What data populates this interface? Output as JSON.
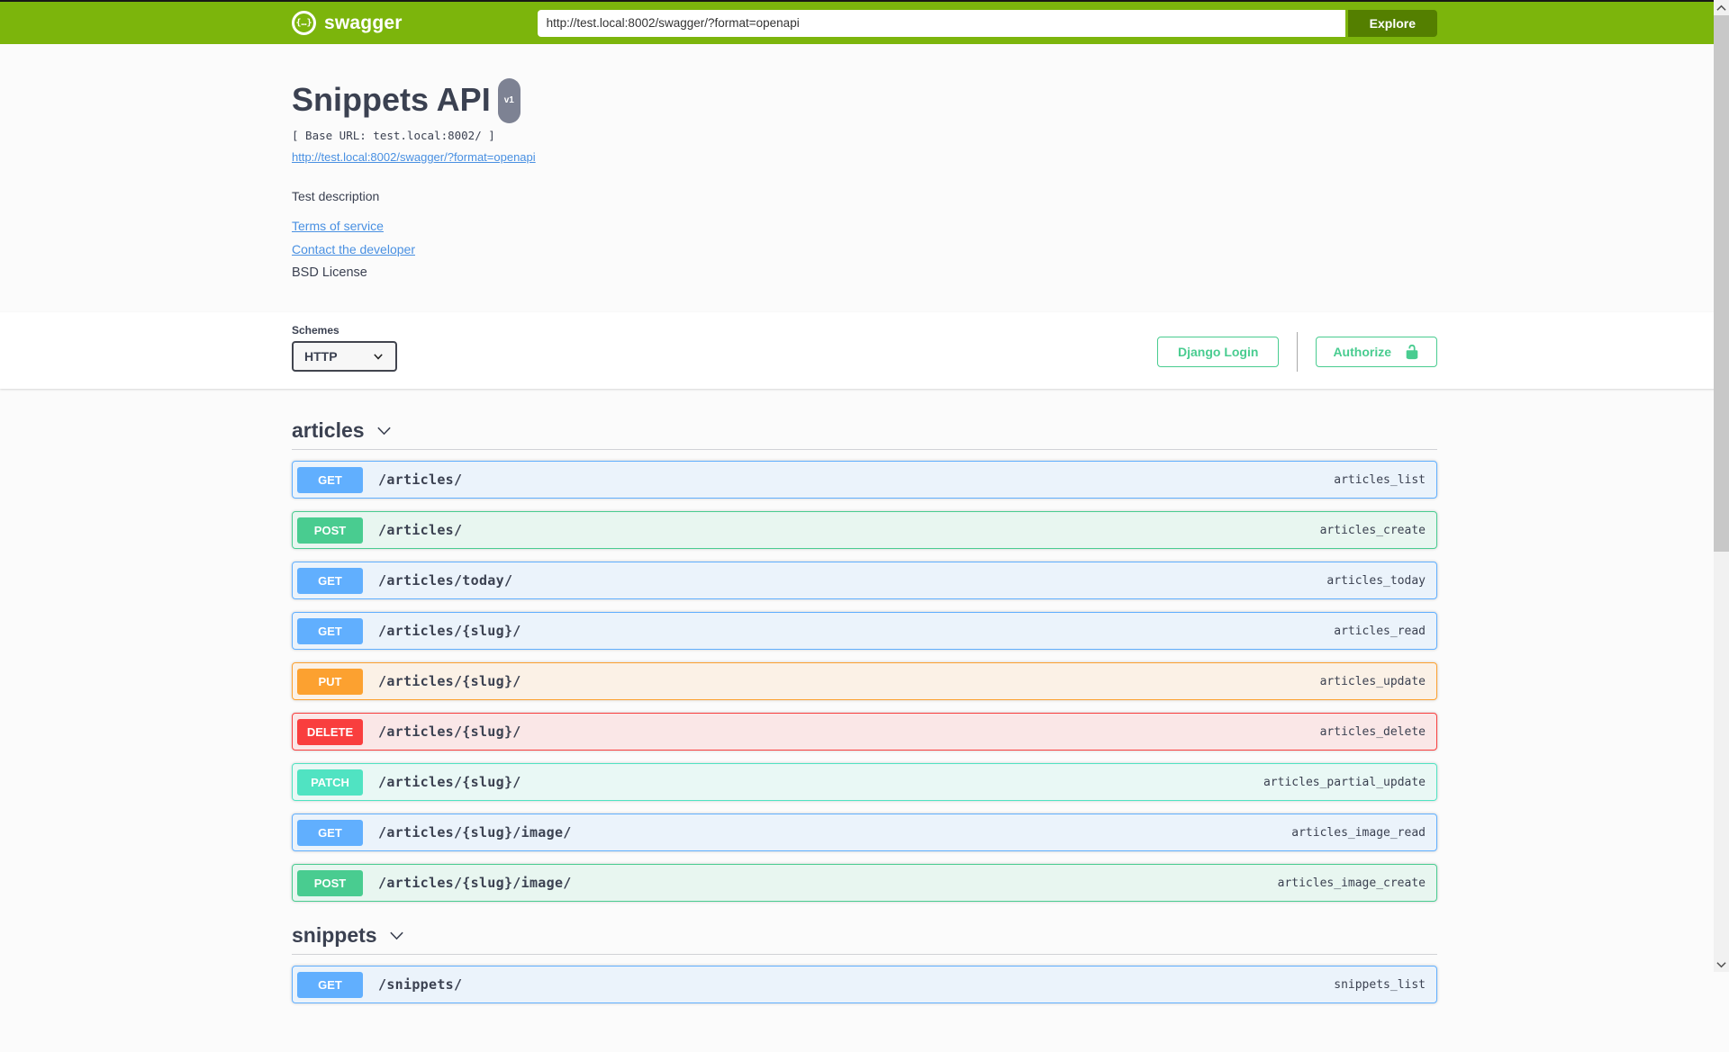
{
  "topbar": {
    "brand": "swagger",
    "logo_glyph": "{…}",
    "url_value": "http://test.local:8002/swagger/?format=openapi",
    "explore_label": "Explore"
  },
  "info": {
    "title": "Snippets API",
    "version_badge": "v1",
    "base_url": "[ Base URL: test.local:8002/ ]",
    "spec_link": "http://test.local:8002/swagger/?format=openapi",
    "description": "Test description",
    "terms_link": "Terms of service",
    "contact_link": "Contact the developer",
    "license": "BSD License"
  },
  "schemes": {
    "label": "Schemes",
    "selected": "HTTP"
  },
  "auth": {
    "django_login_label": "Django Login",
    "authorize_label": "Authorize"
  },
  "colors": {
    "topbar_bg": "#7cb50c",
    "explore_bg": "#547f00",
    "accent_green": "#49cc90",
    "link_blue": "#4990e2",
    "text_dark": "#3b4151",
    "version_badge_bg": "#7d8293",
    "methods": {
      "GET": "#61affe",
      "POST": "#49cc90",
      "PUT": "#fca130",
      "DELETE": "#f93e3e",
      "PATCH": "#50e3c2"
    }
  },
  "sections": [
    {
      "name": "articles",
      "operations": [
        {
          "method": "GET",
          "path": "/articles/",
          "operation_id": "articles_list"
        },
        {
          "method": "POST",
          "path": "/articles/",
          "operation_id": "articles_create"
        },
        {
          "method": "GET",
          "path": "/articles/today/",
          "operation_id": "articles_today"
        },
        {
          "method": "GET",
          "path": "/articles/{slug}/",
          "operation_id": "articles_read"
        },
        {
          "method": "PUT",
          "path": "/articles/{slug}/",
          "operation_id": "articles_update"
        },
        {
          "method": "DELETE",
          "path": "/articles/{slug}/",
          "operation_id": "articles_delete"
        },
        {
          "method": "PATCH",
          "path": "/articles/{slug}/",
          "operation_id": "articles_partial_update"
        },
        {
          "method": "GET",
          "path": "/articles/{slug}/image/",
          "operation_id": "articles_image_read"
        },
        {
          "method": "POST",
          "path": "/articles/{slug}/image/",
          "operation_id": "articles_image_create"
        }
      ]
    },
    {
      "name": "snippets",
      "operations": [
        {
          "method": "GET",
          "path": "/snippets/",
          "operation_id": "snippets_list"
        }
      ]
    }
  ]
}
